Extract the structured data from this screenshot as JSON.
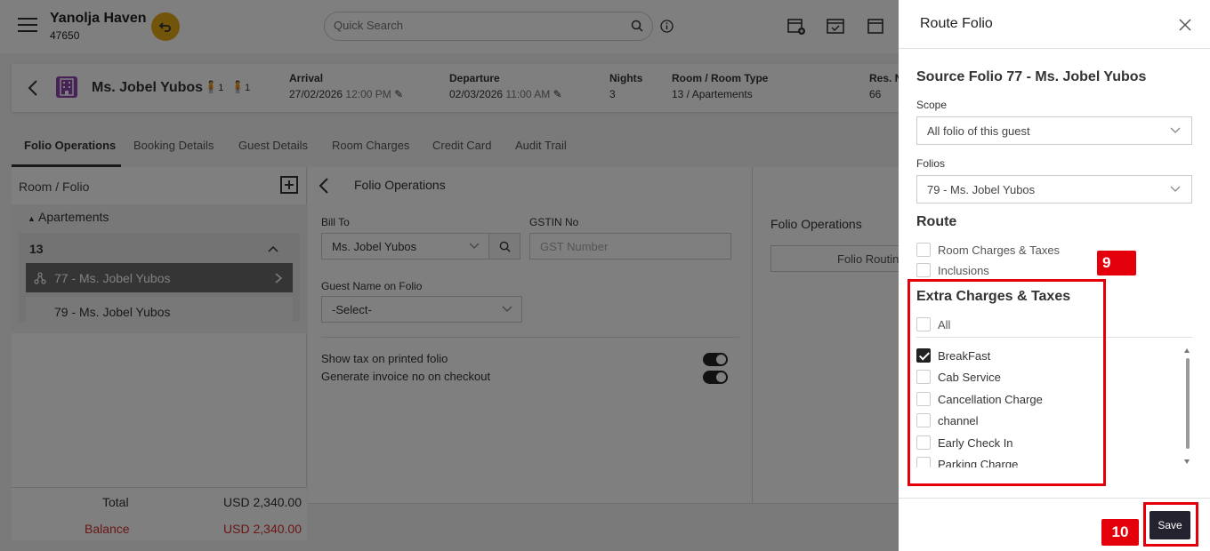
{
  "header": {
    "hotel_name": "Yanolja Haven",
    "hotel_code": "47650",
    "search_placeholder": "Quick Search"
  },
  "guest": {
    "name": "Ms. Jobel Yubos",
    "adults": "1",
    "children": "1",
    "arrival_label": "Arrival",
    "arrival_date": "27/02/2026",
    "arrival_time": "12:00 PM",
    "departure_label": "Departure",
    "departure_date": "02/03/2026",
    "departure_time": "11:00 AM",
    "nights_label": "Nights",
    "nights": "3",
    "room_label": "Room / Room Type",
    "room_value": "13 / Apartements",
    "res_label": "Res. N",
    "res_value": "66"
  },
  "tabs": [
    "Folio Operations",
    "Booking Details",
    "Guest Details",
    "Room Charges",
    "Credit Card",
    "Audit Trail"
  ],
  "left_panel": {
    "title": "Room / Folio",
    "group": "Apartements",
    "room": "13",
    "folios": [
      "77 - Ms. Jobel Yubos",
      "79 - Ms. Jobel Yubos"
    ],
    "total_label": "Total",
    "total_value": "USD 2,340.00",
    "balance_label": "Balance",
    "balance_value": "USD 2,340.00"
  },
  "folio_ops": {
    "title": "Folio Operations",
    "bill_to_label": "Bill To",
    "bill_to_value": "Ms. Jobel Yubos",
    "gstin_label": "GSTIN No",
    "gstin_placeholder": "GST Number",
    "guest_name_label": "Guest Name on Folio",
    "guest_name_value": "-Select-",
    "show_tax_label": "Show tax on printed folio",
    "gen_invoice_label": "Generate invoice no on checkout",
    "right_title": "Folio Operations",
    "routing_button": "Folio Routine"
  },
  "drawer": {
    "title": "Route Folio",
    "source": "Source Folio 77 - Ms. Jobel Yubos",
    "scope_label": "Scope",
    "scope_value": "All folio of this guest",
    "folios_label": "Folios",
    "folios_value": "79 - Ms. Jobel Yubos",
    "route_title": "Route",
    "route_options": [
      {
        "label": "Room Charges & Taxes",
        "checked": false
      },
      {
        "label": "Inclusions",
        "checked": false
      }
    ],
    "extra_title": "Extra Charges & Taxes",
    "all_label": "All",
    "extra_items": [
      {
        "label": "BreakFast",
        "checked": true
      },
      {
        "label": "Cab Service",
        "checked": false
      },
      {
        "label": "Cancellation Charge",
        "checked": false
      },
      {
        "label": "channel",
        "checked": false
      },
      {
        "label": "Early Check In",
        "checked": false
      },
      {
        "label": "Parking Charge",
        "checked": false
      }
    ],
    "save_label": "Save"
  },
  "annotations": {
    "step_9": "9",
    "step_10": "10",
    "highlight_color": "#e3000b"
  },
  "colors": {
    "accent_dark": "#23222e",
    "selected_folio": "#6d6a6a",
    "undo_button": "#e4a817",
    "balance": "#d32f2f"
  }
}
